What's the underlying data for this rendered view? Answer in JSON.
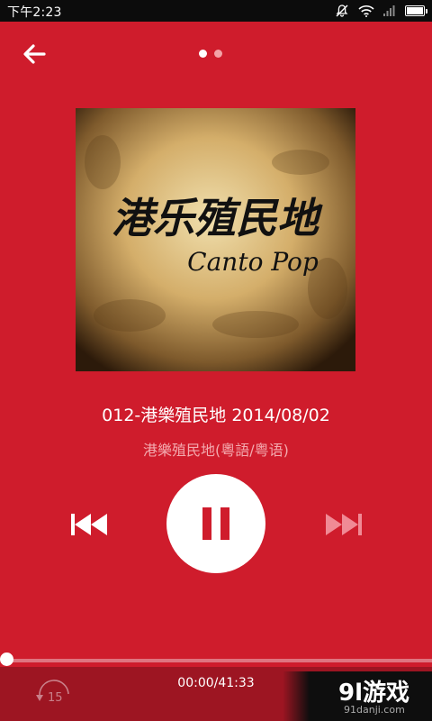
{
  "status_bar": {
    "time": "下午2:23"
  },
  "header": {
    "back_icon": "arrow-left-icon",
    "page_indicator": {
      "count": 2,
      "active_index": 0
    }
  },
  "album_art": {
    "title": "港乐殖民地",
    "subtitle": "Canto Pop"
  },
  "track": {
    "title": "012-港樂殖民地 2014/08/02",
    "artist": "港樂殖民地(粵語/粤语)"
  },
  "controls": {
    "prev_icon": "skip-previous-icon",
    "play_state_icon": "pause-icon",
    "next_icon": "skip-next-icon"
  },
  "playback": {
    "progress_fraction": 0,
    "time_display": "00:00/41:33",
    "rewind_seconds": "15"
  },
  "watermark": {
    "brand": "9l游戏",
    "url": "91danji.com"
  },
  "colors": {
    "background": "#cf1c2c",
    "bottom_bar": "#9d1522",
    "accent_white": "#ffffff"
  }
}
